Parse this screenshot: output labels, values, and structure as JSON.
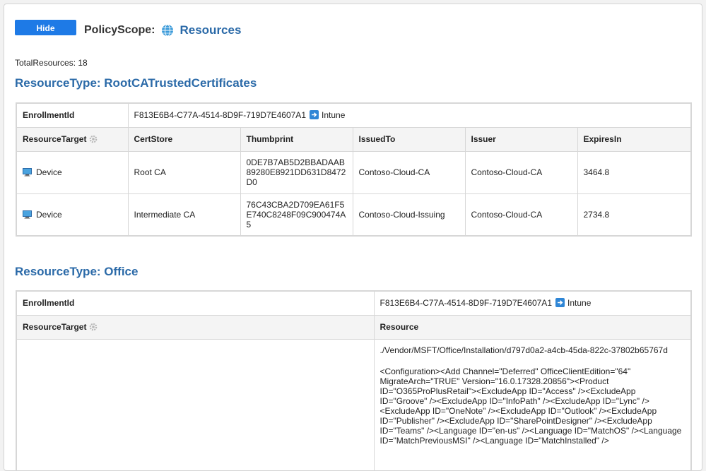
{
  "header": {
    "hide_label": "Hide",
    "policy_scope_label": "PolicyScope:",
    "policy_scope_value": "Resources",
    "total_resources": "TotalResources: 18"
  },
  "sections": [
    {
      "heading": "ResourceType: RootCATrustedCertificates",
      "enrollment_label": "EnrollmentId",
      "enrollment_id": "F813E6B4-C77A-4514-8D9F-719D7E4607A1",
      "enrollment_provider": "Intune",
      "columns": [
        "ResourceTarget",
        "CertStore",
        "Thumbprint",
        "IssuedTo",
        "Issuer",
        "ExpiresIn"
      ],
      "rows": [
        {
          "target": "Device",
          "cert_store": "Root CA",
          "thumbprint": "0DE7B7AB5D2BBADAAB89280E8921DD631D8472D0",
          "issued_to": "Contoso-Cloud-CA",
          "issuer": "Contoso-Cloud-CA",
          "expires_in": "3464.8"
        },
        {
          "target": "Device",
          "cert_store": "Intermediate CA",
          "thumbprint": "76C43CBA2D709EA61F5E740C8248F09C900474A5",
          "issued_to": "Contoso-Cloud-Issuing",
          "issuer": "Contoso-Cloud-CA",
          "expires_in": "2734.8"
        }
      ]
    },
    {
      "heading": "ResourceType: Office",
      "enrollment_label": "EnrollmentId",
      "enrollment_id": "F813E6B4-C77A-4514-8D9F-719D7E4607A1",
      "enrollment_provider": "Intune",
      "columns": [
        "ResourceTarget",
        "Resource"
      ],
      "resource_path": "./Vendor/MSFT/Office/Installation/d797d0a2-a4cb-45da-822c-37802b65767d",
      "resource_config": "<Configuration><Add Channel=\"Deferred\" OfficeClientEdition=\"64\" MigrateArch=\"TRUE\" Version=\"16.0.17328.20856\"><Product ID=\"O365ProPlusRetail\"><ExcludeApp ID=\"Access\" /><ExcludeApp ID=\"Groove\" /><ExcludeApp ID=\"InfoPath\" /><ExcludeApp ID=\"Lync\" /><ExcludeApp ID=\"OneNote\" /><ExcludeApp ID=\"Outlook\" /><ExcludeApp ID=\"Publisher\" /><ExcludeApp ID=\"SharePointDesigner\" /><ExcludeApp ID=\"Teams\" /><Language ID=\"en-us\" /><Language ID=\"MatchOS\" /><Language ID=\"MatchPreviousMSI\" /><Language ID=\"MatchInstalled\" />"
    }
  ],
  "icons": {
    "globe": "globe-icon",
    "arrow": "arrow-right-icon",
    "gear": "gear-icon",
    "device": "computer-icon"
  },
  "colors": {
    "accent": "#1e7ae6",
    "heading": "#2b6aa8"
  }
}
